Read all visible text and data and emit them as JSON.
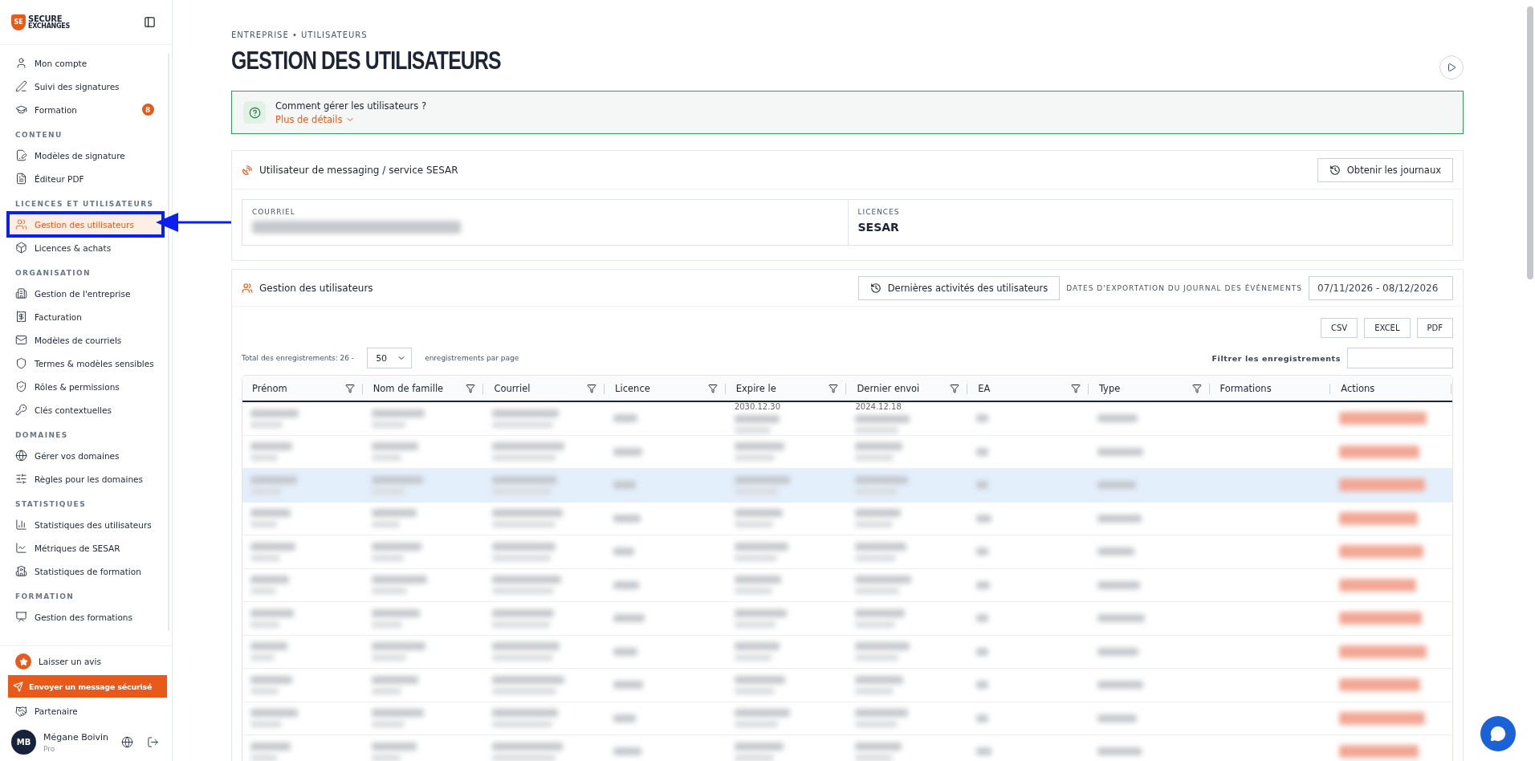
{
  "sidebar": {
    "logo": {
      "mark": "SE",
      "top": "SECURE",
      "bottom": "EXCHANGES"
    },
    "sections": [
      {
        "items": [
          {
            "label": "Mon compte",
            "selected": false
          },
          {
            "label": "Suivi des signatures",
            "selected": false
          },
          {
            "label": "Formation",
            "selected": false,
            "badge": "8"
          }
        ]
      },
      {
        "heading": "CONTENU",
        "items": [
          {
            "label": "Modèles de signature",
            "selected": false
          },
          {
            "label": "Éditeur PDF",
            "selected": false
          }
        ]
      },
      {
        "heading": "LICENCES ET UTILISATEURS",
        "items": [
          {
            "label": "Gestion des utilisateurs",
            "selected": true
          },
          {
            "label": "Licences & achats",
            "selected": false
          }
        ]
      },
      {
        "heading": "ORGANISATION",
        "items": [
          {
            "label": "Gestion de l'entreprise",
            "selected": false
          },
          {
            "label": "Facturation",
            "selected": false
          },
          {
            "label": "Modèles de courriels",
            "selected": false
          },
          {
            "label": "Termes & modèles sensibles",
            "selected": false
          },
          {
            "label": "Rôles & permissions",
            "selected": false
          },
          {
            "label": "Clés contextuelles",
            "selected": false
          }
        ]
      },
      {
        "heading": "DOMAINES",
        "items": [
          {
            "label": "Gérer vos domaines",
            "selected": false
          },
          {
            "label": "Règles pour les domaines",
            "selected": false
          }
        ]
      },
      {
        "heading": "STATISTIQUES",
        "items": [
          {
            "label": "Statistiques des utilisateurs",
            "selected": false
          },
          {
            "label": "Métriques de SESAR",
            "selected": false
          },
          {
            "label": "Statistiques de formation",
            "selected": false
          }
        ]
      },
      {
        "heading": "FORMATION",
        "items": [
          {
            "label": "Gestion des formations",
            "selected": false
          }
        ]
      }
    ],
    "review": "Laisser un avis",
    "send_button": "Envoyer un message sécurisé",
    "partner": "Partenaire",
    "user": {
      "initials": "MB",
      "name": "Mégane Boivin",
      "plan": "Pro"
    }
  },
  "page": {
    "breadcrumb": "ENTREPRISE • UTILISATEURS",
    "title": "GESTION DES UTILISATEURS",
    "help": {
      "question": "Comment gérer les utilisateurs ?",
      "link": "Plus de détails"
    },
    "service_card": {
      "title": "Utilisateur de messaging / service SESAR",
      "button": "Obtenir les journaux",
      "fields": [
        {
          "label": "COURRIEL"
        },
        {
          "label": "LICENCES",
          "value": "SESAR"
        }
      ]
    },
    "users_card": {
      "title": "Gestion des utilisateurs",
      "activity_button": "Dernières activités des utilisateurs",
      "export_label": "DATES D'EXPORTATION DU JOURNAL DES ÉVÉNEMENTS",
      "date_range": "07/11/2026 - 08/12/2026",
      "export_buttons": [
        "CSV",
        "EXCEL",
        "PDF"
      ],
      "total": "Total des enregistrements: 26 -",
      "page_size": "50",
      "per_page": "enregistrements par page",
      "filter_label": "Filtrer les enregistrements",
      "columns": [
        {
          "label": "Prénom",
          "filterable": true
        },
        {
          "label": "Nom de famille",
          "filterable": true
        },
        {
          "label": "Courriel",
          "filterable": true
        },
        {
          "label": "Licence",
          "filterable": true
        },
        {
          "label": "Expire le",
          "filterable": true
        },
        {
          "label": "Dernier envoi",
          "filterable": true
        },
        {
          "label": "EA",
          "filterable": true
        },
        {
          "label": "Type",
          "filterable": true
        },
        {
          "label": "Formations",
          "filterable": false
        },
        {
          "label": "Actions",
          "filterable": false
        }
      ],
      "rows": [
        {
          "selected": false,
          "cells": [
            null,
            null,
            null,
            null,
            "2030.12.30",
            "2024.12.18",
            null,
            null,
            null,
            null
          ]
        },
        {
          "selected": false
        },
        {
          "selected": true
        },
        {
          "selected": false
        },
        {
          "selected": false
        },
        {
          "selected": false
        },
        {
          "selected": false
        },
        {
          "selected": false
        },
        {
          "selected": false
        },
        {
          "selected": false
        },
        {
          "selected": false
        }
      ]
    }
  }
}
